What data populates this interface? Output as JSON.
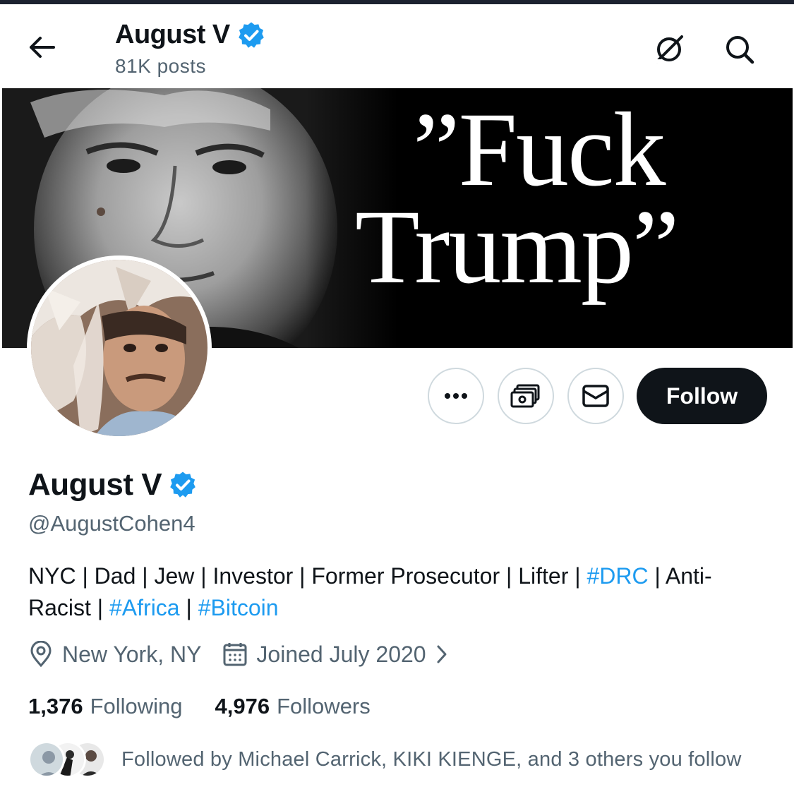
{
  "header": {
    "title": "August V",
    "posts": "81K posts",
    "icons": {
      "back": "back-arrow-icon",
      "grok": "grok-icon",
      "search": "search-icon"
    }
  },
  "banner": {
    "quote_line1": "”Fuck",
    "quote_line2": "Trump”"
  },
  "actions": {
    "more_icon": "more-icon",
    "tip_icon": "money-icon",
    "message_icon": "envelope-icon",
    "follow_label": "Follow"
  },
  "profile": {
    "name": "August V",
    "verified": true,
    "handle": "@AugustCohen4",
    "bio": {
      "text1": "NYC | Dad | Jew | Investor | Former Prosecutor | Lifter | ",
      "tag1": "#DRC",
      "text2": " | Anti-Racist | ",
      "tag2": "#Africa",
      "text3": " | ",
      "tag3": "#Bitcoin"
    },
    "location": "New York, NY",
    "joined": "Joined July 2020",
    "following_count": "1,376",
    "following_label": "Following",
    "followers_count": "4,976",
    "followers_label": "Followers",
    "followed_by": "Followed by Michael Carrick, KIKI KIENGE, and 3 others you follow"
  },
  "colors": {
    "accent": "#1d9bf0",
    "text": "#0f1419",
    "secondary": "#536471",
    "button_dark": "#0f1419",
    "border": "#cfd9de"
  }
}
